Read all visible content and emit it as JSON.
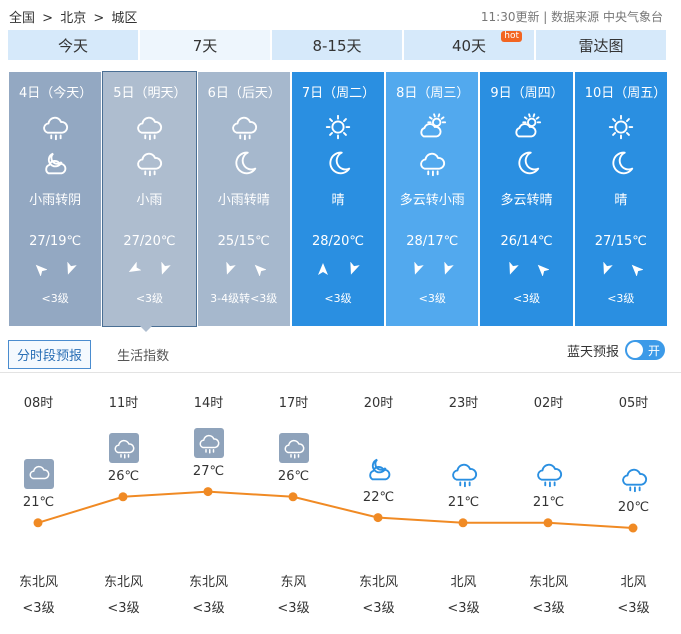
{
  "breadcrumb": [
    "全国",
    ">",
    "北京",
    ">",
    "城区"
  ],
  "update_time": "11:30更新",
  "source": "数据来源 中央气象台",
  "source_sep": "|",
  "tabs": [
    {
      "label": "今天"
    },
    {
      "label": "7天",
      "active": true
    },
    {
      "label": "8-15天"
    },
    {
      "label": "40天",
      "badge": "hot"
    },
    {
      "label": "雷达图"
    }
  ],
  "days": [
    {
      "date": "4日（今天）",
      "icon1": "rain-cloud-icon",
      "icon2": "cloud-moon-icon",
      "cond": "小雨转阴",
      "temp": "27/19℃",
      "level": "<3级"
    },
    {
      "date": "5日（明天）",
      "icon1": "rain-cloud-icon",
      "icon2": "rain-cloud-icon",
      "cond": "小雨",
      "temp": "27/20℃",
      "level": "<3级"
    },
    {
      "date": "6日（后天）",
      "icon1": "rain-cloud-icon",
      "icon2": "moon-icon",
      "cond": "小雨转晴",
      "temp": "25/15℃",
      "level": "3-4级转<3级"
    },
    {
      "date": "7日（周二）",
      "icon1": "sun-icon",
      "icon2": "moon-icon",
      "cond": "晴",
      "temp": "28/20℃",
      "level": "<3级"
    },
    {
      "date": "8日（周三）",
      "icon1": "sun-cloud-icon",
      "icon2": "rain-cloud-icon",
      "cond": "多云转小雨",
      "temp": "28/17℃",
      "level": "<3级"
    },
    {
      "date": "9日（周四）",
      "icon1": "sun-cloud-icon",
      "icon2": "moon-icon",
      "cond": "多云转晴",
      "temp": "26/14℃",
      "level": "<3级"
    },
    {
      "date": "10日（周五）",
      "icon1": "sun-icon",
      "icon2": "moon-icon",
      "cond": "晴",
      "temp": "27/15℃",
      "level": "<3级"
    }
  ],
  "subtabs": [
    {
      "label": "分时段预报",
      "active": true
    },
    {
      "label": "生活指数"
    }
  ],
  "blue_sky": {
    "label": "蓝天预报",
    "toggle": "开"
  },
  "hourly": [
    {
      "time": "08时",
      "temp": "21℃",
      "wind": "东北风",
      "level": "<3级",
      "icon": "cloud-icon"
    },
    {
      "time": "11时",
      "temp": "26℃",
      "wind": "东北风",
      "level": "<3级",
      "icon": "rain-cloud-icon"
    },
    {
      "time": "14时",
      "temp": "27℃",
      "wind": "东北风",
      "level": "<3级",
      "icon": "rain-cloud-icon"
    },
    {
      "time": "17时",
      "temp": "26℃",
      "wind": "东风",
      "level": "<3级",
      "icon": "rain-cloud-icon"
    },
    {
      "time": "20时",
      "temp": "22℃",
      "wind": "东北风",
      "level": "<3级",
      "icon": "cloud-moon-icon"
    },
    {
      "time": "23时",
      "temp": "21℃",
      "wind": "北风",
      "level": "<3级",
      "icon": "rain-cloud-icon"
    },
    {
      "time": "02时",
      "temp": "21℃",
      "wind": "东北风",
      "level": "<3级",
      "icon": "rain-cloud-icon"
    },
    {
      "time": "05时",
      "temp": "20℃",
      "wind": "北风",
      "level": "<3级",
      "icon": "rain-cloud-icon"
    }
  ],
  "colors": {
    "accent": "#2a8fe1",
    "curve": "#f08a24"
  },
  "chart_data": {
    "type": "line",
    "categories": [
      "08时",
      "11时",
      "14时",
      "17时",
      "20时",
      "23时",
      "02时",
      "05时"
    ],
    "values": [
      21,
      26,
      27,
      26,
      22,
      21,
      21,
      20
    ]
  }
}
